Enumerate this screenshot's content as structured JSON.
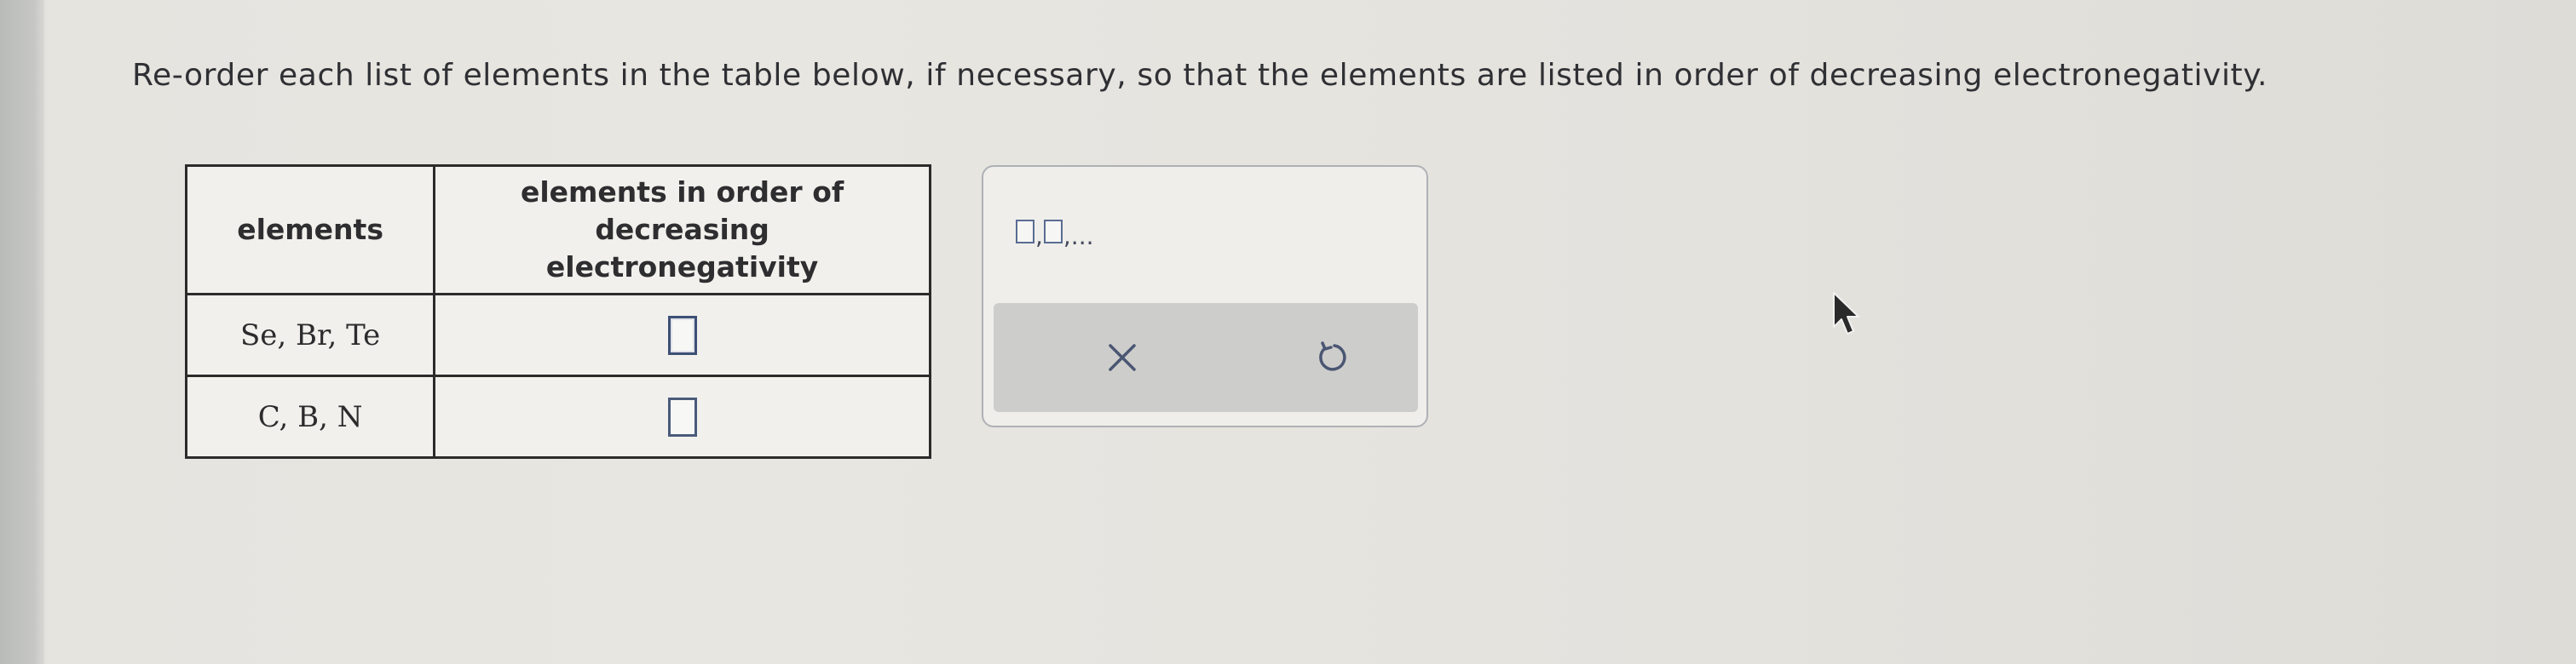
{
  "question": {
    "text": "Re-order each list of elements in the table below, if necessary, so that the elements are listed in order of decreasing electronegativity."
  },
  "table": {
    "headers": [
      "elements",
      "elements in order of decreasing electronegativity"
    ],
    "rows": [
      {
        "elements": "Se, Br, Te",
        "answer": ""
      },
      {
        "elements": "C, B, N",
        "answer": ""
      }
    ]
  },
  "tool_panel": {
    "template_label": "□,□,...",
    "template_suffix": ",...",
    "clear_icon": "x-icon",
    "reset_icon": "undo-icon"
  },
  "colors": {
    "text": "#2f3034",
    "table_border": "#2b2b2b",
    "answer_box_border": "#4a5a7a",
    "action_bar": "#cdcdcb",
    "icon": "#4a5672"
  }
}
